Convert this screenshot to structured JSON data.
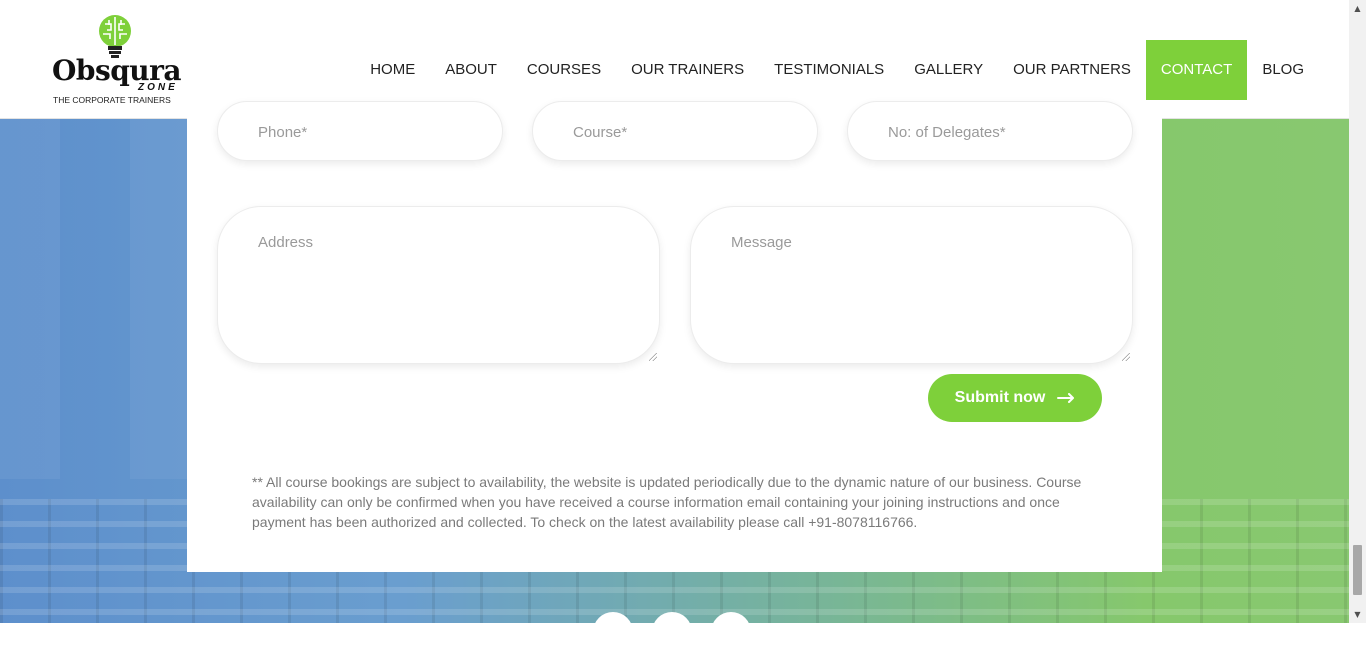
{
  "brand": {
    "name": "Obsqura",
    "sub": "ZONE",
    "tagline": "THE CORPORATE TRAINERS"
  },
  "nav": {
    "items": [
      {
        "label": "HOME"
      },
      {
        "label": "ABOUT"
      },
      {
        "label": "COURSES"
      },
      {
        "label": "OUR TRAINERS"
      },
      {
        "label": "TESTIMONIALS"
      },
      {
        "label": "GALLERY"
      },
      {
        "label": "OUR PARTNERS"
      },
      {
        "label": "CONTACT",
        "active": true
      },
      {
        "label": "BLOG"
      }
    ]
  },
  "form": {
    "phone_placeholder": "Phone*",
    "course_placeholder": "Course*",
    "delegates_placeholder": "No: of Delegates*",
    "address_placeholder": "Address",
    "message_placeholder": "Message",
    "submit_label": "Submit now",
    "submit_icon": "arrow-right-icon"
  },
  "notice": "** All course bookings are subject to availability, the website is updated periodically due to the dynamic nature of our business. Course availability can only be confirmed when you have received a course information email containing your joining instructions and once payment has been authorized and collected. To check on the latest availability please call +91-8078116766.",
  "colors": {
    "accent": "#7ed03a",
    "text": "#222222",
    "muted": "#9a9a9a"
  }
}
